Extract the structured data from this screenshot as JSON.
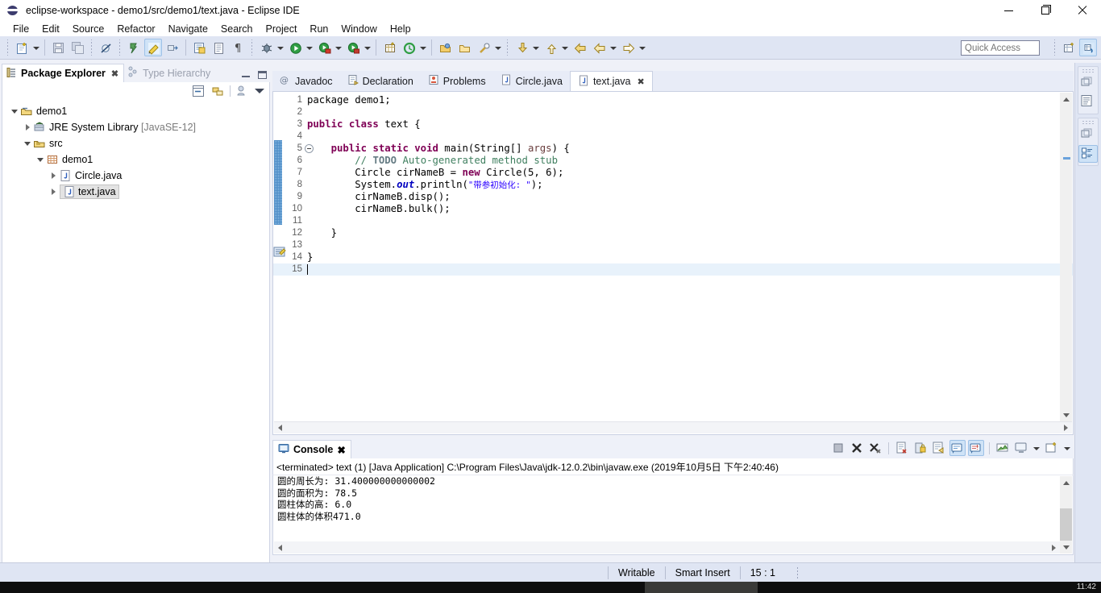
{
  "window": {
    "title": "eclipse-workspace - demo1/src/demo1/text.java - Eclipse IDE",
    "minimize_label": "Minimize",
    "maximize_label": "Restore",
    "close_label": "Close"
  },
  "menu": {
    "items": [
      "File",
      "Edit",
      "Source",
      "Refactor",
      "Navigate",
      "Search",
      "Project",
      "Run",
      "Window",
      "Help"
    ]
  },
  "toolbar": {
    "quick_access_placeholder": "Quick Access",
    "buttons": [
      {
        "name": "new-wizard",
        "label": "New"
      },
      {
        "name": "save",
        "label": "Save"
      },
      {
        "name": "save-all",
        "label": "Save All"
      },
      {
        "name": "skip-all-breakpoints",
        "label": "Skip All Breakpoints"
      },
      {
        "name": "toggle-mark-occurrences",
        "label": "Toggle Mark Occurrences"
      },
      {
        "name": "annotation-highlight",
        "label": "Next Annotation"
      },
      {
        "name": "link-with-editor",
        "label": "Link With Editor"
      },
      {
        "name": "new-java-class",
        "label": "New Java Class"
      },
      {
        "name": "open-task",
        "label": "Open Task"
      },
      {
        "name": "show-whitespace",
        "label": "Show Whitespace Characters"
      },
      {
        "name": "debug",
        "label": "Debug"
      },
      {
        "name": "run",
        "label": "Run"
      },
      {
        "name": "run-last-tool",
        "label": "External Tools"
      },
      {
        "name": "coverage",
        "label": "Coverage"
      },
      {
        "name": "new-java-project",
        "label": "New Java Project"
      },
      {
        "name": "new-annotation",
        "label": "New Annotation"
      },
      {
        "name": "open-type",
        "label": "Open Type"
      },
      {
        "name": "open-task-2",
        "label": "Open Task"
      },
      {
        "name": "search",
        "label": "Search"
      },
      {
        "name": "next-edit-location",
        "label": "Next Edit Location"
      },
      {
        "name": "previous-edit-location",
        "label": "Previous Edit Location"
      },
      {
        "name": "back",
        "label": "Back"
      },
      {
        "name": "forward",
        "label": "Forward"
      }
    ],
    "right_buttons": [
      {
        "name": "open-perspective",
        "label": "Open Perspective"
      },
      {
        "name": "java-perspective",
        "label": "Java"
      }
    ]
  },
  "package_explorer": {
    "tabs": [
      {
        "label": "Package Explorer",
        "active": true,
        "closable": true
      },
      {
        "label": "Type Hierarchy",
        "active": false,
        "closable": false
      }
    ],
    "view_toolbar": [
      {
        "name": "collapse-all",
        "label": "Collapse All"
      },
      {
        "name": "link-with-editor",
        "label": "Link with Editor"
      },
      {
        "name": "focus-on-active-task",
        "label": "Focus on Active Task"
      },
      {
        "name": "view-menu",
        "label": "View Menu"
      }
    ],
    "tree": [
      {
        "label": "demo1",
        "suffix": "",
        "icon": "java-project-icon",
        "depth": 0,
        "twist": "down",
        "selected": false
      },
      {
        "label": "JRE System Library",
        "suffix": "[JavaSE-12]",
        "icon": "library-icon",
        "depth": 1,
        "twist": "right",
        "selected": false
      },
      {
        "label": "src",
        "suffix": "",
        "icon": "source-folder-icon",
        "depth": 1,
        "twist": "down",
        "selected": false
      },
      {
        "label": "demo1",
        "suffix": "",
        "icon": "package-icon",
        "depth": 2,
        "twist": "down",
        "selected": false
      },
      {
        "label": "Circle.java",
        "suffix": "",
        "icon": "java-file-icon",
        "depth": 3,
        "twist": "right",
        "selected": false
      },
      {
        "label": "text.java",
        "suffix": "",
        "icon": "java-file-icon",
        "depth": 3,
        "twist": "right",
        "selected": true
      }
    ]
  },
  "editor": {
    "tabs": [
      {
        "label": "Javadoc",
        "icon": "javadoc-icon",
        "active": false,
        "closable": false
      },
      {
        "label": "Declaration",
        "icon": "declaration-icon",
        "active": false,
        "closable": false
      },
      {
        "label": "Problems",
        "icon": "problems-icon",
        "active": false,
        "closable": false
      },
      {
        "label": "Circle.java",
        "icon": "java-file-icon",
        "active": false,
        "closable": false
      },
      {
        "label": "text.java",
        "icon": "java-file-icon",
        "active": true,
        "closable": true
      }
    ],
    "lines": [
      {
        "n": "1",
        "tokens": [
          {
            "t": "package demo1;",
            "c": ""
          }
        ]
      },
      {
        "n": "2",
        "tokens": []
      },
      {
        "n": "3",
        "tokens": [
          {
            "t": "public class",
            "c": "kw"
          },
          {
            "t": " text {",
            "c": ""
          }
        ]
      },
      {
        "n": "4",
        "tokens": []
      },
      {
        "n": "5",
        "tokens": [
          {
            "t": "    ",
            "c": ""
          },
          {
            "t": "public static void",
            "c": "kw"
          },
          {
            "t": " main(String[] ",
            "c": ""
          },
          {
            "t": "args",
            "c": "par"
          },
          {
            "t": ") {",
            "c": ""
          }
        ],
        "fold": true
      },
      {
        "n": "6",
        "tokens": [
          {
            "t": "        ",
            "c": ""
          },
          {
            "t": "// ",
            "c": "cmt"
          },
          {
            "t": "TODO",
            "c": "todo"
          },
          {
            "t": " Auto-generated method stub",
            "c": "cmt"
          }
        ],
        "marker": "todo-marker"
      },
      {
        "n": "7",
        "tokens": [
          {
            "t": "        Circle cirNameB = ",
            "c": ""
          },
          {
            "t": "new",
            "c": "kw"
          },
          {
            "t": " Circle(5, 6);",
            "c": ""
          }
        ]
      },
      {
        "n": "8",
        "tokens": [
          {
            "t": "        System.",
            "c": ""
          },
          {
            "t": "out",
            "c": "fld"
          },
          {
            "t": ".println(",
            "c": ""
          },
          {
            "t": "\"带参初始化: \"",
            "c": "str"
          },
          {
            "t": ");",
            "c": ""
          }
        ]
      },
      {
        "n": "9",
        "tokens": [
          {
            "t": "        cirNameB.disp();",
            "c": ""
          }
        ]
      },
      {
        "n": "10",
        "tokens": [
          {
            "t": "        cirNameB.bulk();",
            "c": ""
          }
        ]
      },
      {
        "n": "11",
        "tokens": []
      },
      {
        "n": "12",
        "tokens": [
          {
            "t": "    }",
            "c": ""
          }
        ]
      },
      {
        "n": "13",
        "tokens": []
      },
      {
        "n": "14",
        "tokens": [
          {
            "t": "}",
            "c": ""
          }
        ]
      },
      {
        "n": "15",
        "tokens": [],
        "highlight": true,
        "caret": true
      }
    ]
  },
  "console": {
    "tab_label": "Console",
    "header": "<terminated> text (1) [Java Application] C:\\Program Files\\Java\\jdk-12.0.2\\bin\\javaw.exe (2019年10月5日 下午2:40:46)",
    "output": [
      "圆的周长为: 31.400000000000002",
      "圆的面积为: 78.5",
      "圆柱体的高: 6.0",
      "圆柱体的体积471.0"
    ],
    "toolbar": [
      {
        "name": "terminate",
        "label": "Terminate",
        "active": false
      },
      {
        "name": "remove-launch",
        "label": "Remove Launch",
        "active": false
      },
      {
        "name": "remove-all-terminated",
        "label": "Remove All Terminated Launches",
        "active": false
      },
      {
        "name": "clear-console",
        "label": "Clear Console",
        "active": false
      },
      {
        "name": "scroll-lock",
        "label": "Scroll Lock",
        "active": false
      },
      {
        "name": "word-wrap",
        "label": "Word Wrap",
        "active": false
      },
      {
        "name": "show-console-on-output",
        "label": "Show Console When Standard Out Changes",
        "active": true
      },
      {
        "name": "show-console-on-error",
        "label": "Show Console When Standard Error Changes",
        "active": true
      },
      {
        "name": "pin-console",
        "label": "Pin Console",
        "active": false
      },
      {
        "name": "display-selected-console",
        "label": "Display Selected Console",
        "active": false
      },
      {
        "name": "open-console",
        "label": "Open Console",
        "active": false
      }
    ]
  },
  "right_bar": {
    "groups": [
      [
        {
          "name": "restore-editor",
          "label": "Restore"
        },
        {
          "name": "outline-view",
          "label": "Outline"
        }
      ],
      [
        {
          "name": "restore-explorer",
          "label": "Restore"
        },
        {
          "name": "package-explorer-view",
          "label": "Package Explorer"
        }
      ]
    ]
  },
  "status_bar": {
    "writable": "Writable",
    "insert_mode": "Smart Insert",
    "cursor_position": "15 : 1"
  },
  "taskbar": {
    "clock": "11:42"
  },
  "colors": {
    "accent": "#2f79bd",
    "chrome": "#dfe5f3",
    "keyword": "#7f0055",
    "string": "#2a00ff",
    "comment": "#3f7f5f",
    "field": "#0000c0",
    "parameter": "#6a3e3e"
  }
}
